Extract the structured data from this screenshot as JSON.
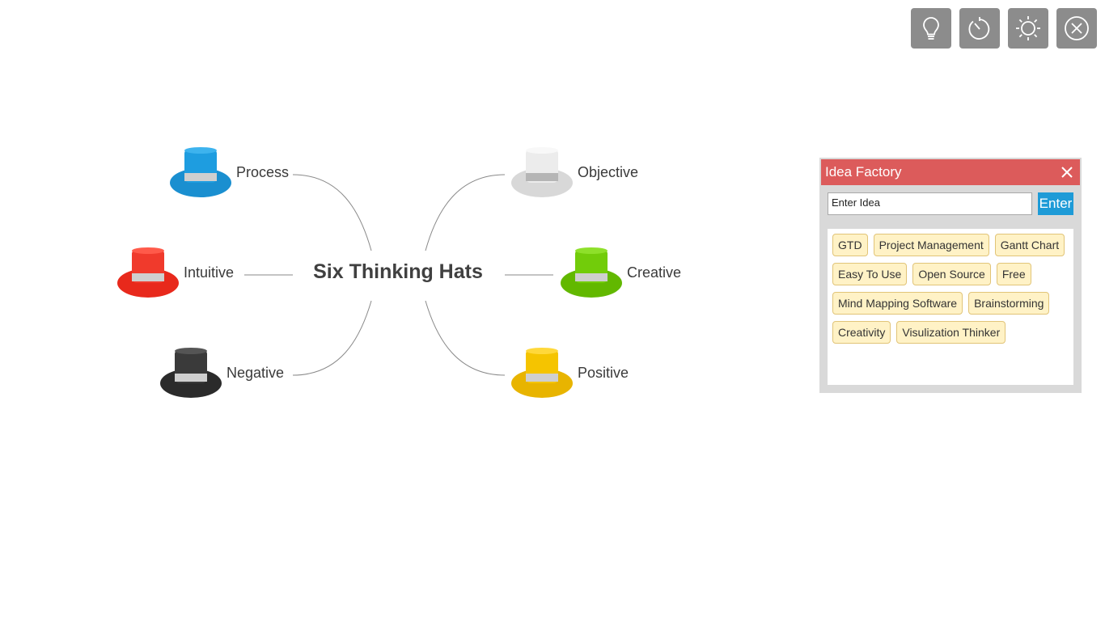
{
  "toolbar": {
    "buttons": [
      {
        "icon": "lightbulb-icon"
      },
      {
        "icon": "timer-icon"
      },
      {
        "icon": "brightness-icon"
      },
      {
        "icon": "close-icon"
      }
    ]
  },
  "mindmap": {
    "center": "Six Thinking Hats",
    "nodes": [
      {
        "label": "Process",
        "hat_color": "#1a8fd0"
      },
      {
        "label": "Intuitive",
        "hat_color": "#e8291c"
      },
      {
        "label": "Negative",
        "hat_color": "#2b2b2b"
      },
      {
        "label": "Objective",
        "hat_color": "#e6e6e6"
      },
      {
        "label": "Creative",
        "hat_color": "#62b800"
      },
      {
        "label": "Positive",
        "hat_color": "#e8b400"
      }
    ]
  },
  "idea_factory": {
    "title": "Idea Factory",
    "input_value": "Enter Idea",
    "enter_label": "Enter",
    "header_color": "#dc5b5b",
    "tags": [
      "GTD",
      "Project Management",
      "Gantt Chart",
      "Easy To Use",
      "Open Source",
      "Free",
      "Mind Mapping Software",
      "Brainstorming",
      "Creativity",
      "Visulization Thinker"
    ]
  }
}
